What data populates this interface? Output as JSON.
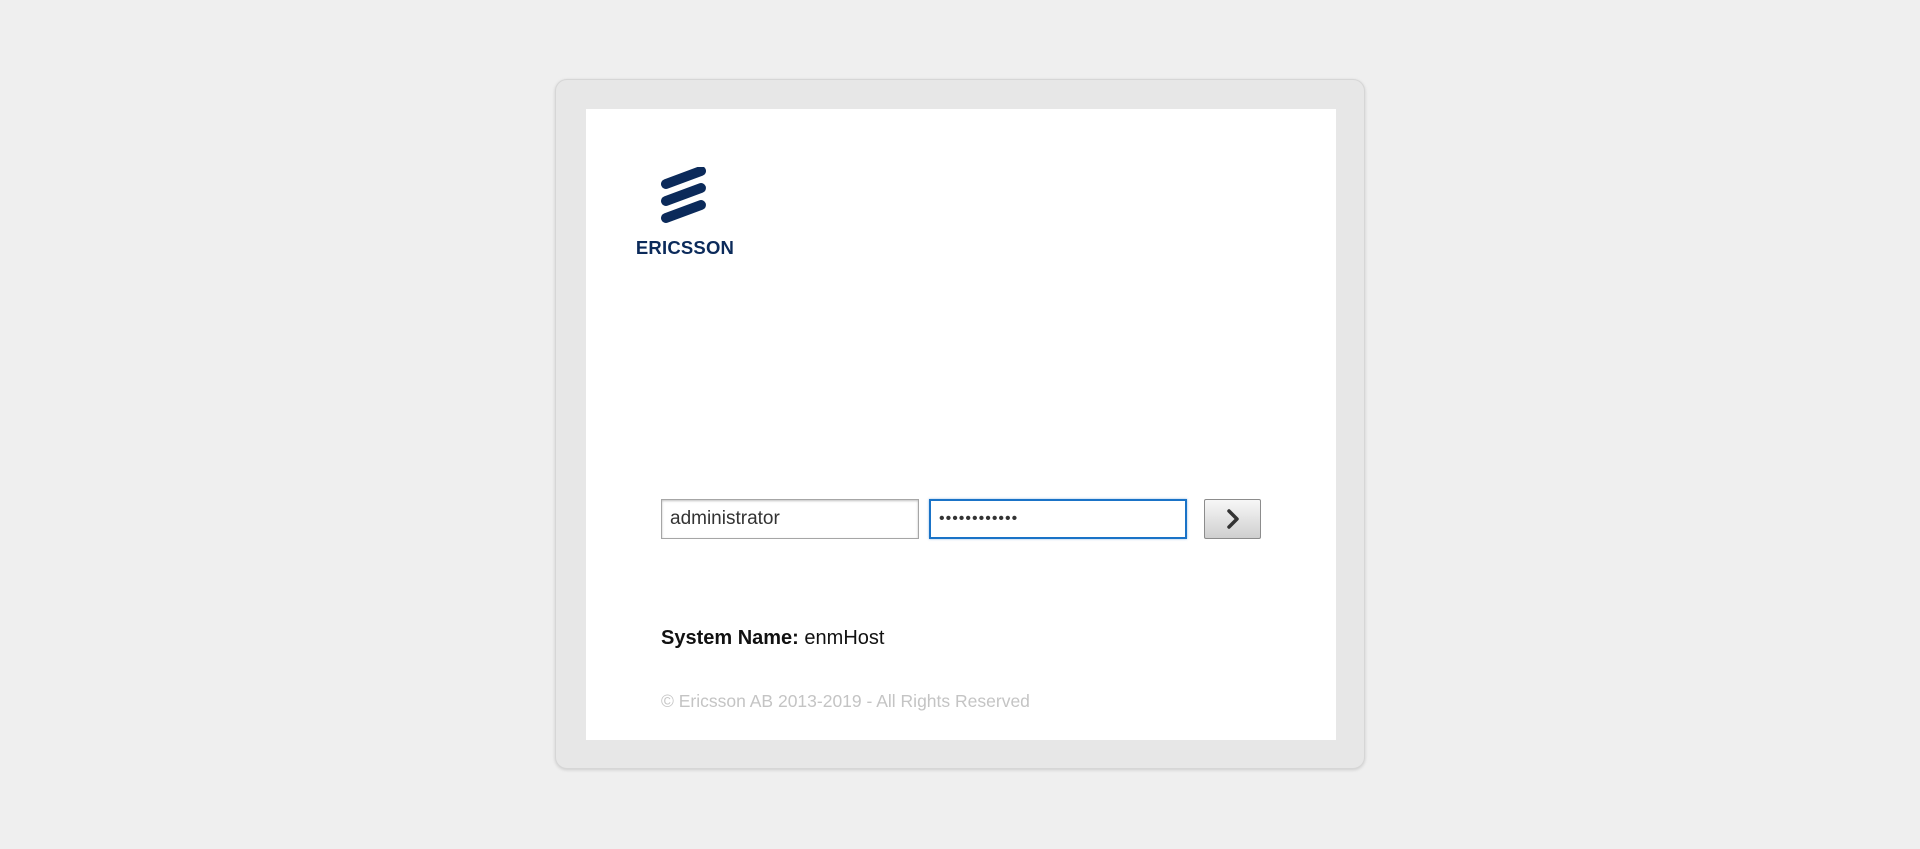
{
  "logo": {
    "icon": "ericsson-logo-icon",
    "text": "ERICSSON",
    "color": "#0b2a5a"
  },
  "login": {
    "username_value": "administrator",
    "password_value": "••••••••••••",
    "submit_icon": "chevron-right-icon",
    "focus_color": "#1a73c7"
  },
  "system": {
    "label": "System Name:",
    "value": "enmHost"
  },
  "footer": {
    "copyright": "© Ericsson AB 2013-2019 - All Rights Reserved"
  }
}
